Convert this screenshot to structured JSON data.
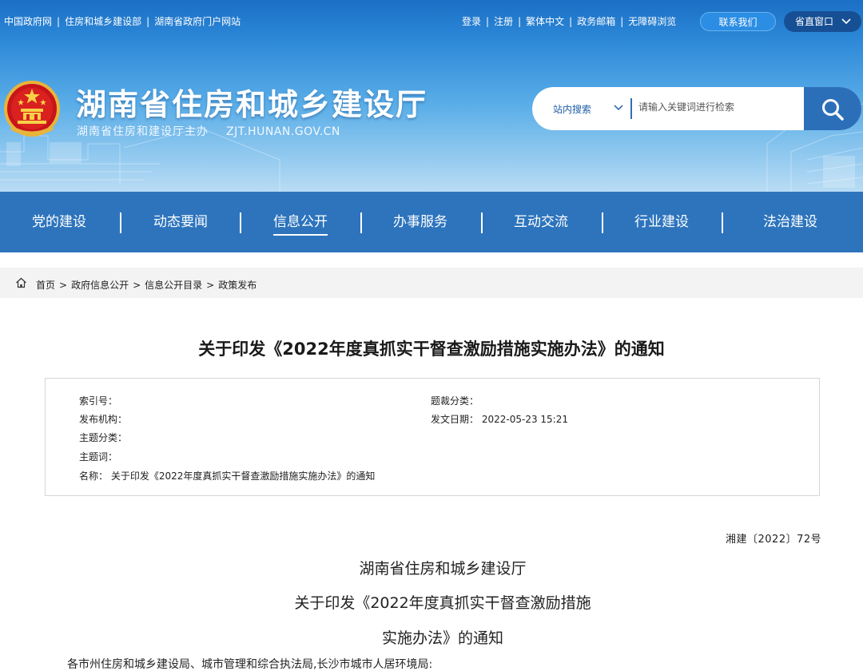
{
  "topbar": {
    "left_links": [
      "中国政府网",
      "住房和城乡建设部",
      "湖南省政府门户网站"
    ],
    "right_links": [
      "登录",
      "注册",
      "繁体中文",
      "政务邮箱",
      "无障碍浏览"
    ],
    "contact_label": "联系我们",
    "window_label": "省直窗口"
  },
  "site": {
    "title": "湖南省住房和城乡建设厅",
    "subtitle": "湖南省住房和建设厅主办",
    "domain": "ZJT.HUNAN.GOV.CN"
  },
  "search": {
    "scope": "站内搜索",
    "placeholder": "请输入关键词进行检索"
  },
  "nav": {
    "items": [
      "党的建设",
      "动态要闻",
      "信息公开",
      "办事服务",
      "互动交流",
      "行业建设",
      "法治建设"
    ],
    "active": "信息公开"
  },
  "breadcrumb": [
    "首页",
    "政府信息公开",
    "信息公开目录",
    "政策发布"
  ],
  "article": {
    "title": "关于印发《2022年度真抓实干督查激励措施实施办法》的通知",
    "meta": {
      "index_no_label": "索引号：",
      "index_no": "",
      "genre_label": "题裁分类：",
      "genre": "",
      "issuer_label": "发布机构：",
      "issuer": "",
      "date_label": "发文日期：",
      "date": "2022-05-23 15:21",
      "topic_label": "主题分类：",
      "topic": "",
      "keywords_label": "主题词：",
      "keywords": "",
      "name_label": "名称：",
      "name": "关于印发《2022年度真抓实干督查激励措施实施办法》的通知"
    },
    "doc_number": "湘建〔2022〕72号",
    "doc_org": "湖南省住房和城乡建设厅",
    "doc_title_line1": "关于印发《2022年度真抓实干督查激励措施",
    "doc_title_line2": "实施办法》的通知",
    "recipients": "各市州住房和城乡建设局、城市管理和综合执法局,长沙市城市人居环境局:"
  },
  "colors": {
    "header_blue": "#2a85d6",
    "nav_blue": "#2d74bd",
    "search_button": "#2c6fb9",
    "window_button": "#174f95"
  },
  "icons": {
    "emblem": "national-emblem-icon",
    "search": "search-icon",
    "home": "home-icon",
    "chevron": "chevron-down-icon"
  }
}
